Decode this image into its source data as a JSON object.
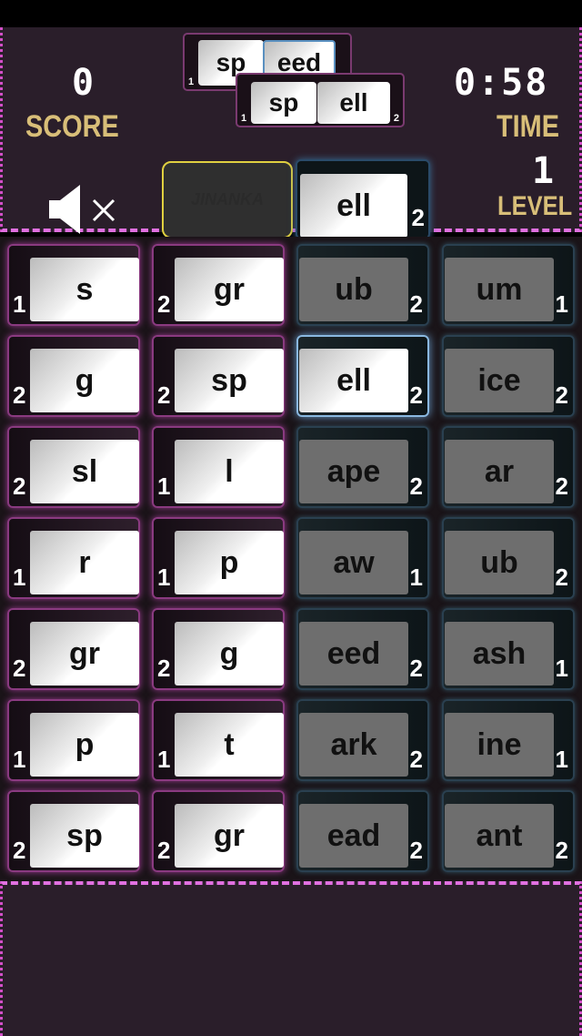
{
  "score": {
    "value": "0",
    "label": "SCORE"
  },
  "time": {
    "value": "0:58",
    "label": "TIME"
  },
  "level": {
    "value": "1",
    "label": "LEVEL"
  },
  "sound": {
    "icon": "speaker-muted-icon"
  },
  "slot": {
    "logo": "JINANKA"
  },
  "history": [
    {
      "prefix": "sp",
      "prefix_num": "1",
      "suffix": "eed",
      "suffix_num": "2"
    },
    {
      "prefix": "sp",
      "prefix_num": "1",
      "suffix": "ell",
      "suffix_num": "2"
    }
  ],
  "current": {
    "suffix": "ell",
    "num": "2"
  },
  "grid": [
    [
      {
        "t": "s",
        "n": "1"
      },
      {
        "t": "gr",
        "n": "2"
      },
      {
        "t": "ub",
        "n": "2"
      },
      {
        "t": "um",
        "n": "1"
      }
    ],
    [
      {
        "t": "g",
        "n": "2"
      },
      {
        "t": "sp",
        "n": "2"
      },
      {
        "t": "ell",
        "n": "2"
      },
      {
        "t": "ice",
        "n": "2"
      }
    ],
    [
      {
        "t": "sl",
        "n": "2"
      },
      {
        "t": "l",
        "n": "1"
      },
      {
        "t": "ape",
        "n": "2"
      },
      {
        "t": "ar",
        "n": "2"
      }
    ],
    [
      {
        "t": "r",
        "n": "1"
      },
      {
        "t": "p",
        "n": "1"
      },
      {
        "t": "aw",
        "n": "1"
      },
      {
        "t": "ub",
        "n": "2"
      }
    ],
    [
      {
        "t": "gr",
        "n": "2"
      },
      {
        "t": "g",
        "n": "2"
      },
      {
        "t": "eed",
        "n": "2"
      },
      {
        "t": "ash",
        "n": "1"
      }
    ],
    [
      {
        "t": "p",
        "n": "1"
      },
      {
        "t": "t",
        "n": "1"
      },
      {
        "t": "ark",
        "n": "2"
      },
      {
        "t": "ine",
        "n": "1"
      }
    ],
    [
      {
        "t": "sp",
        "n": "2"
      },
      {
        "t": "gr",
        "n": "2"
      },
      {
        "t": "ead",
        "n": "2"
      },
      {
        "t": "ant",
        "n": "2"
      }
    ]
  ],
  "selected": {
    "row": 1,
    "col": 2
  },
  "colors": {
    "prefix_border": "#8a3a80",
    "suffix_border": "#2a4050",
    "gold": "#d8be78",
    "slot_border": "#e0d040"
  }
}
